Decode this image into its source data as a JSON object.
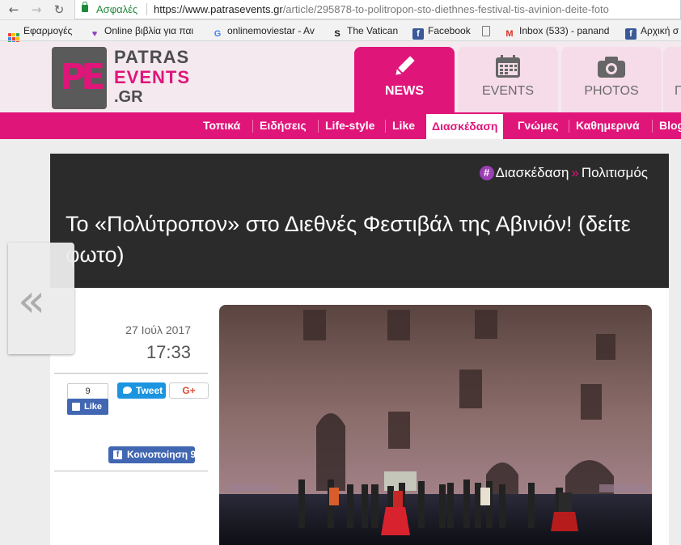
{
  "browser": {
    "secure_label": "Ασφαλές",
    "url_host": "https://www.patrasevents.gr",
    "url_path": "/article/295878-to-politropon-sto-diethnes-festival-tis-avinion-deite-foto",
    "bookmarks": [
      {
        "label": "Εφαρμογές",
        "icon": "apps-icon"
      },
      {
        "label": "Online βιβλία για παι",
        "icon": "book-heart-icon"
      },
      {
        "label": "onlinemoviestar - Av",
        "icon": "google-icon"
      },
      {
        "label": "The Vatican",
        "icon": "s-logo-icon"
      },
      {
        "label": "Facebook",
        "icon": "facebook-icon"
      },
      {
        "label": "",
        "icon": "blank-page-icon"
      },
      {
        "label": "Inbox (533) - panand",
        "icon": "gmail-icon"
      },
      {
        "label": "Αρχική σ",
        "icon": "facebook-icon"
      }
    ]
  },
  "site": {
    "logo_mark": "PE",
    "logo_line1": "PATRAS",
    "logo_line2": "EVENTS",
    "logo_line3": ".GR",
    "tabs": [
      {
        "label": "NEWS",
        "icon": "pencil-icon",
        "active": true
      },
      {
        "label": "EVENTS",
        "icon": "calendar-icon",
        "active": false
      },
      {
        "label": "PHOTOS",
        "icon": "camera-icon",
        "active": false
      },
      {
        "label": "Γ",
        "icon": "partial-tab",
        "active": false
      }
    ],
    "categories": [
      "Τοπικά",
      "Ειδήσεις",
      "Life-style",
      "Like",
      "Διασκέδαση",
      "Γνώμες",
      "Καθημερινά",
      "Blog"
    ],
    "active_category": "Διασκέδαση"
  },
  "article": {
    "breadcrumb_hash": "#",
    "breadcrumb_section": "Διασκέδαση",
    "breadcrumb_sep": "»",
    "breadcrumb_sub": "Πολιτισμός",
    "title": "Το «Πολύτροπον» στο Διεθνές Φεστιβάλ της Αβινιόν! (δείτε φωτο)",
    "date": "27 Ιούλ 2017",
    "time": "17:33",
    "prev_arrow": "«"
  },
  "social": {
    "like_count": "9",
    "like_label": "Like",
    "tweet_label": "Tweet",
    "gplus_label": "G+",
    "share_label": "Κοινοποίηση 9"
  },
  "colors": {
    "brand_pink": "#e0157a",
    "header_bg": "#f4e9ee",
    "article_head_bg": "#2b2b2b",
    "facebook_blue": "#4267b2",
    "twitter_blue": "#1b95e0"
  }
}
